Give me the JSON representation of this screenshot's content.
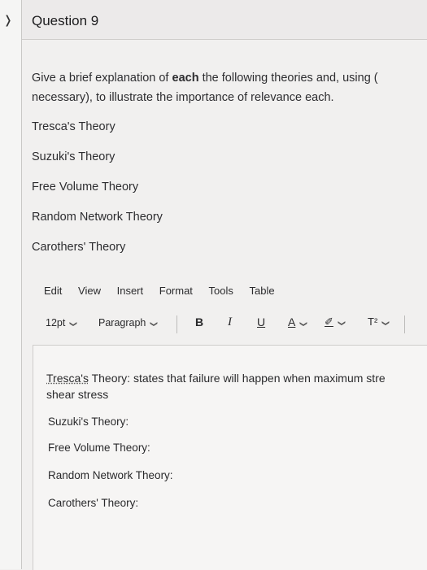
{
  "question": {
    "title": "Question 9",
    "prompt_line1_pre": "Give a brief explanation of ",
    "prompt_line1_bold": "each",
    "prompt_line1_post": " the following theories and, using (",
    "prompt_line2": "necessary), to illustrate the importance of relevance each.",
    "theories": [
      "Tresca's Theory",
      "Suzuki's Theory",
      "Free Volume Theory",
      "Random Network Theory",
      "Carothers' Theory"
    ]
  },
  "editor": {
    "menu": [
      "Edit",
      "View",
      "Insert",
      "Format",
      "Tools",
      "Table"
    ],
    "font_size": "12pt",
    "block_format": "Paragraph",
    "bold_label": "B",
    "italic_label": "I",
    "underline_label": "U",
    "text_color_label": "A",
    "highlight_label": "✐",
    "superscript_label": "T²",
    "answer": {
      "tresca_word": "Tresca's",
      "tresca_rest": " Theory: states that failure will happen when maximum stre",
      "tresca_cont": "shear stress",
      "lines": [
        "Suzuki's Theory:",
        "Free Volume Theory:",
        "Random Network Theory:",
        "Carothers' Theory:"
      ]
    }
  },
  "icons": {
    "collapse": "chevron-right-icon",
    "dropdown": "chevron-down-icon"
  }
}
